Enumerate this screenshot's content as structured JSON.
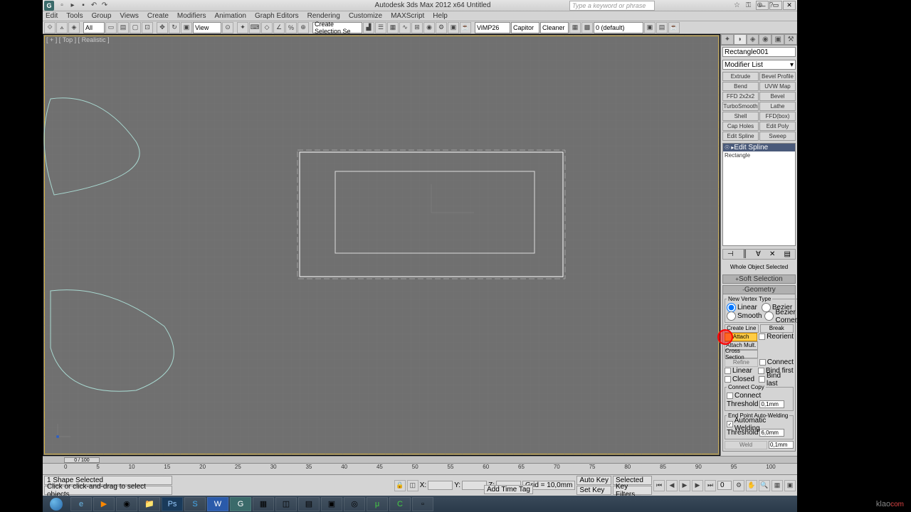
{
  "title": "Autodesk 3ds Max 2012 x64     Untitled",
  "menubar": [
    "Edit",
    "Tools",
    "Group",
    "Views",
    "Create",
    "Modifiers",
    "Animation",
    "Graph Editors",
    "Rendering",
    "Customize",
    "MAXScript",
    "Help"
  ],
  "search_placeholder": "Type a keyword or phrase",
  "toolbar": {
    "sel_filter": "All",
    "view_drop": "View",
    "create_sel": "Create Selection Se",
    "vr1": "ViMP26",
    "vr2": "Capitor",
    "vr3": "Cleaner",
    "preset": "0 (default)"
  },
  "viewport": {
    "label": "[ + ] [ Top ] [ Realistic ]"
  },
  "cmd": {
    "name": "Rectangle001",
    "modlist": "Modifier List",
    "buttons": [
      "Extrude",
      "Bevel Profile",
      "Bend",
      "UVW Map",
      "FFD 2x2x2",
      "Bevel",
      "TurboSmooth",
      "Lathe",
      "Shell",
      "FFD(box)",
      "Cap Holes",
      "Edit Poly",
      "Edit Spline",
      "Sweep"
    ],
    "stack": {
      "active": "Edit Spline",
      "base": "Rectangle"
    },
    "selection_info": "Whole Object Selected",
    "rollouts": {
      "soft": "Soft Selection",
      "geom": "Geometry"
    },
    "vertex": {
      "legend": "New Vertex Type",
      "linear": "Linear",
      "bezier": "Bezier",
      "smooth": "Smooth",
      "bcorner": "Bezier Corner"
    },
    "geom": {
      "create": "Create Line",
      "break": "Break",
      "attach": "Attach",
      "reorient": "Reorient",
      "attachmult": "Attach Mult.",
      "cross": "Cross Section",
      "refine": "Refine",
      "connect": "Connect",
      "linear": "Linear",
      "bindfirst": "Bind first",
      "closed": "Closed",
      "bindlast": "Bind last",
      "copy": "Connect Copy",
      "connect2": "Connect",
      "threshold": "Threshold",
      "thval": "0,1mm",
      "endpoint": "End Point Auto-Welding",
      "autoweld": "Automatic Welding",
      "thresh2": "Threshold",
      "thval2": "6,0mm",
      "weld": "Weld",
      "weldval": "0,1mm"
    }
  },
  "timeline": {
    "pos": "0 / 100",
    "ticks": [
      "0",
      "5",
      "10",
      "15",
      "20",
      "25",
      "30",
      "35",
      "40",
      "45",
      "50",
      "55",
      "60",
      "65",
      "70",
      "75",
      "80",
      "85",
      "90",
      "95",
      "100"
    ]
  },
  "status": {
    "sel": "1 Shape Selected",
    "hint": "Click or click-and-drag to select objects",
    "x": "X:",
    "y": "Y:",
    "z": "Z:",
    "grid": "Grid = 10,0mm",
    "autokey": "Auto Key",
    "setkey": "Set Key",
    "selected": "Selected",
    "keyfilters": "Key Filters...",
    "addtag": "Add Time Tag"
  }
}
